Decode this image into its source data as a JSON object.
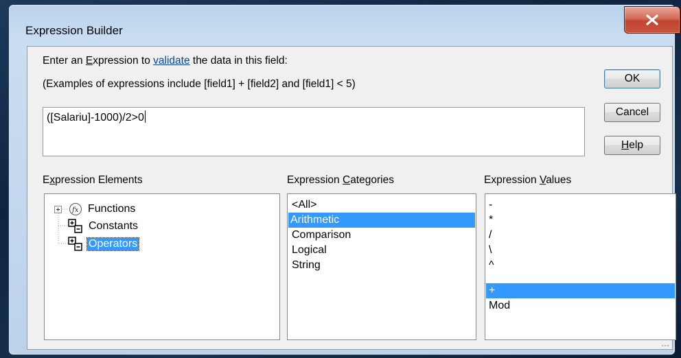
{
  "window": {
    "title": "Expression Builder",
    "close_glyph": "✕"
  },
  "prompt": {
    "line1_part1": "Enter an ",
    "line1_accel": "E",
    "line1_part2": "xpression to ",
    "line1_link": "validate",
    "line1_part3": " the data in this field:",
    "line2": "(Examples of expressions include [field1] + [field2] and [field1] < 5)"
  },
  "expression": {
    "value": "([Salariu]-1000)/2>0"
  },
  "buttons": {
    "ok": "OK",
    "cancel": "Cancel",
    "help_accel": "H",
    "help_rest": "elp"
  },
  "elements": {
    "label_pre": "E",
    "label_accel": "x",
    "label_post": "pression Elements",
    "items": [
      {
        "label": "Functions",
        "icon": "function-icon",
        "expander": "expand-icon",
        "selected": false
      },
      {
        "label": "Constants",
        "icon": "constants-icon",
        "selected": false
      },
      {
        "label": "Operators",
        "icon": "operators-icon",
        "selected": true
      }
    ]
  },
  "categories": {
    "label_pre": "Expression ",
    "label_accel": "C",
    "label_post": "ategories",
    "items": [
      "<All>",
      "Arithmetic",
      "Comparison",
      "Logical",
      "String"
    ],
    "selected_index": 1
  },
  "values": {
    "label_pre": "Expression ",
    "label_accel": "V",
    "label_post": "alues",
    "items": [
      "-",
      "*",
      "/",
      "\\",
      "^",
      "+",
      "Mod"
    ],
    "selected_index": 5
  },
  "colors": {
    "selection": "#3399ff",
    "link": "#0645ad",
    "close": "#c9553f"
  }
}
